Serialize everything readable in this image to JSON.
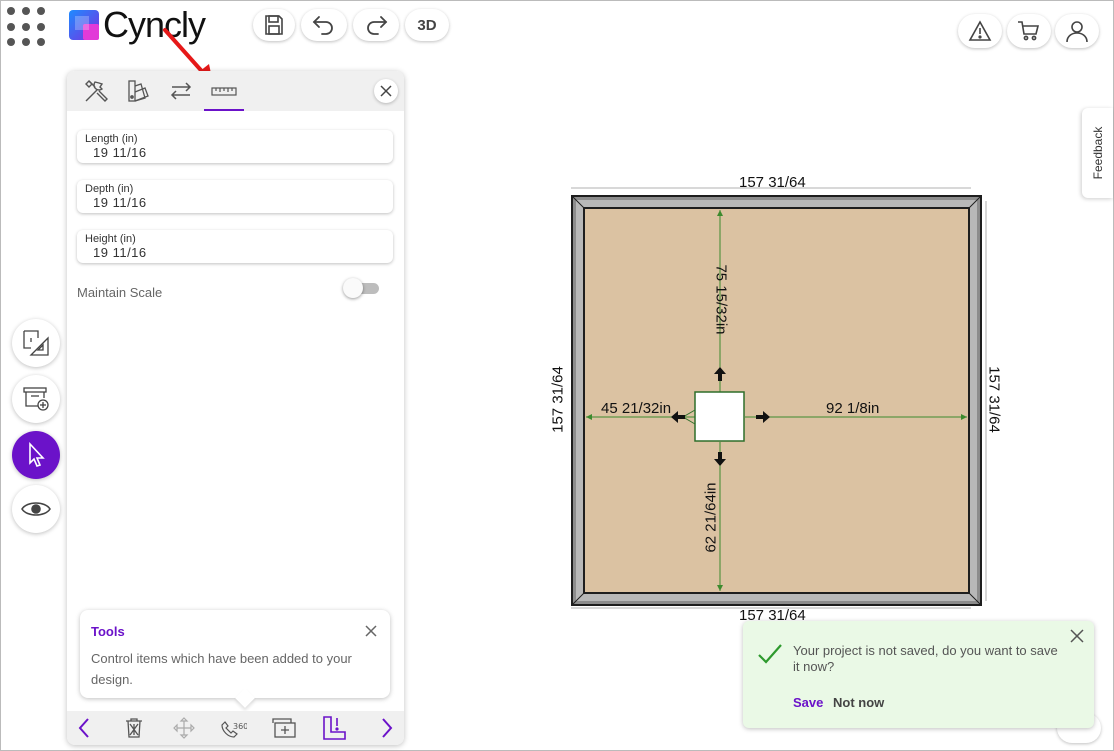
{
  "app": {
    "name": "Cyncly"
  },
  "toolbar": {
    "view_3d_label": "3D"
  },
  "panel": {
    "fields": [
      {
        "label": "Length (in)",
        "value": "19 11/16"
      },
      {
        "label": "Depth (in)",
        "value": "19 11/16"
      },
      {
        "label": "Height (in)",
        "value": "19 11/16"
      }
    ],
    "maintain_scale_label": "Maintain Scale",
    "maintain_scale_on": false
  },
  "tip": {
    "title": "Tools",
    "body": "Control items which have been added to your design."
  },
  "drawing": {
    "dim_top": "157 31/64",
    "dim_bottom": "157 31/64",
    "dim_left": "157 31/64",
    "dim_right": "157 31/64",
    "to_top": "75 15/32in",
    "to_bottom": "62 21/64in",
    "to_left": "45 21/32in",
    "to_right": "92 1/8in"
  },
  "feedback_label": "Feedback",
  "toast": {
    "message": "Your project is not saved, do you want to save it now?",
    "save_label": "Save",
    "not_now_label": "Not now"
  },
  "colors": {
    "accent": "#6b12c9",
    "floor": "#dbc2a2",
    "wall": "#8c8c8c",
    "dimension_line": "#3c8a2e",
    "toast_bg": "#eaf9e6",
    "toast_check": "#2e9a2e"
  },
  "icons": {
    "apps": "grid-icon",
    "save": "floppy-disk-icon",
    "undo": "undo-icon",
    "redo": "redo-icon",
    "warning": "warning-icon",
    "cart": "cart-icon",
    "user": "user-icon"
  }
}
